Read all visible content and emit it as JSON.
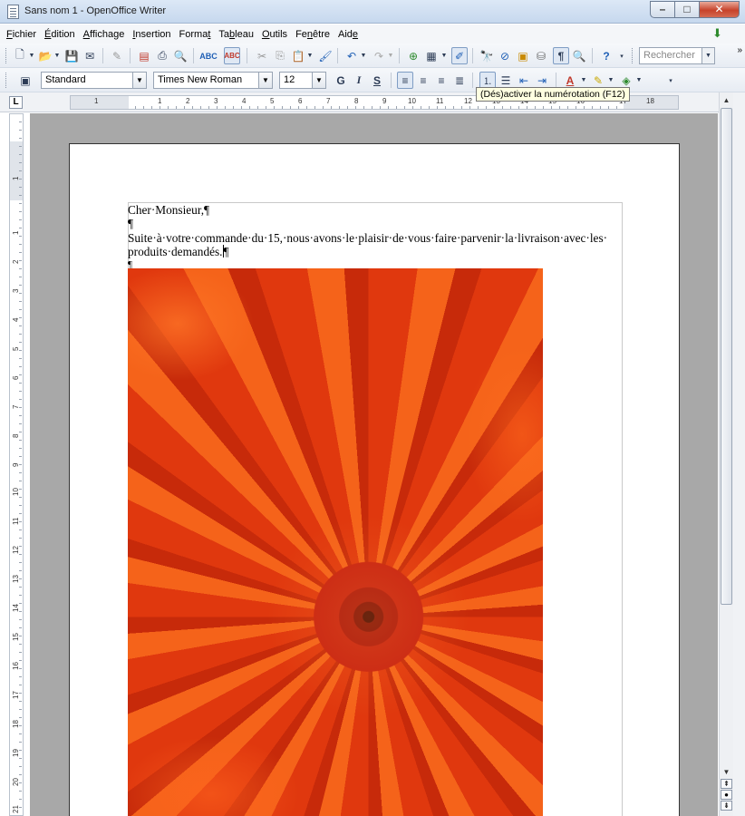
{
  "window": {
    "title": "Sans nom 1 - OpenOffice Writer",
    "controls": {
      "minimize": "–",
      "maximize": "□",
      "close": "✕"
    }
  },
  "menu": [
    {
      "label": "Fichier",
      "accel": "F",
      "rest": "ichier"
    },
    {
      "label": "Édition",
      "accel": "É",
      "rest": "dition"
    },
    {
      "label": "Affichage",
      "accel": "A",
      "rest": "ffichage"
    },
    {
      "label": "Insertion",
      "accel": "I",
      "rest": "nsertion"
    },
    {
      "label": "Format",
      "pre": "Forma",
      "accel": "t",
      "rest": ""
    },
    {
      "label": "Tableau",
      "pre": "Ta",
      "accel": "b",
      "rest": "leau"
    },
    {
      "label": "Outils",
      "accel": "O",
      "rest": "utils"
    },
    {
      "label": "Fenêtre",
      "pre": "Fe",
      "accel": "n",
      "rest": "être"
    },
    {
      "label": "Aide",
      "pre": "Aid",
      "accel": "e",
      "rest": ""
    }
  ],
  "toolbar_standard": {
    "search_placeholder": "Rechercher"
  },
  "toolbar_format": {
    "paragraph_style": "Standard",
    "font_name": "Times New Roman",
    "font_size": "12",
    "bold": "G",
    "italic": "I",
    "underline": "S",
    "font_color_letter": "A"
  },
  "tooltip": "(Dés)activer la numérotation (F12)",
  "ruler": {
    "horizontal_numbers": [
      "1",
      "1",
      "2",
      "3",
      "4",
      "5",
      "6",
      "7",
      "8",
      "9",
      "10",
      "11",
      "12",
      "13",
      "14",
      "15",
      "16",
      "17",
      "18"
    ],
    "vertical_numbers": [
      "1",
      "1",
      "2",
      "3",
      "4",
      "5",
      "6",
      "7",
      "8",
      "9",
      "10",
      "11",
      "12",
      "13",
      "14",
      "15",
      "16",
      "17",
      "18",
      "19",
      "20",
      "21"
    ],
    "tab_type": "L"
  },
  "document": {
    "greeting": "Cher·Monsieur,¶",
    "empty_para": "¶",
    "body_line1": "Suite·à·votre·commande·du·15,·nous·avons·le·plaisir·de·vous·faire·parvenir·la·livraison·avec·les·",
    "body_line2": "produits·demandés.",
    "body_end_mark": "¶",
    "anchor_para": "¶",
    "picture_subject": "orange chrysanthemum flower"
  },
  "colors": {
    "title_bar": "#c6d8ee",
    "doc_background": "#a8a8a8",
    "tooltip_bg": "#ffffe1",
    "close_button": "#c7432b"
  }
}
